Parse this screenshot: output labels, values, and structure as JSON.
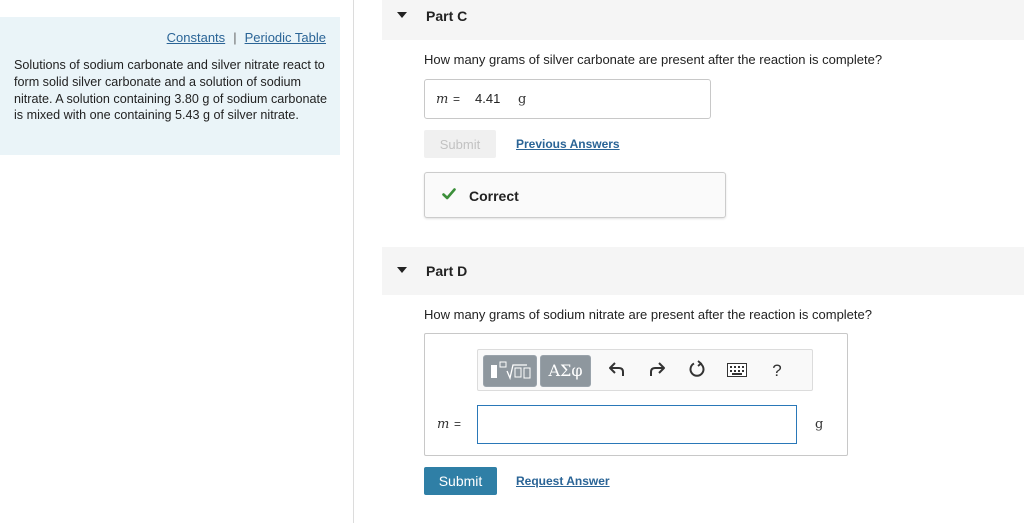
{
  "sidebar": {
    "links": {
      "constants": "Constants",
      "separator": "|",
      "periodic_table": "Periodic Table"
    },
    "problem_text": "Solutions of sodium carbonate and silver nitrate react to form solid silver carbonate and a solution of sodium nitrate. A solution containing 3.80 g of sodium carbonate is mixed with one containing 5.43 g of silver nitrate."
  },
  "part_c": {
    "title": "Part C",
    "question": "How many grams of silver carbonate are present after the reaction is complete?",
    "variable": "m",
    "equals": "=",
    "answer_value": "4.41",
    "unit": "g",
    "submit_label": "Submit",
    "previous_answers_label": "Previous Answers",
    "feedback_label": "Correct",
    "feedback_color": "#3c8f3a"
  },
  "part_d": {
    "title": "Part D",
    "question": "How many grams of sodium nitrate are present after the reaction is complete?",
    "toolbar": {
      "templates_icon": "templates-icon",
      "greek_label": "ΑΣφ",
      "undo_icon": "undo-icon",
      "redo_icon": "redo-icon",
      "reset_icon": "reset-icon",
      "keyboard_icon": "keyboard-icon",
      "help_label": "?"
    },
    "variable": "m",
    "equals": "=",
    "answer_value": "",
    "unit": "g",
    "submit_label": "Submit",
    "request_answer_label": "Request Answer",
    "submit_color": "#2f7fa6"
  },
  "colors": {
    "link": "#2a6496",
    "info_background": "#eaf4f8",
    "part_header_background": "#f5f5f5"
  }
}
